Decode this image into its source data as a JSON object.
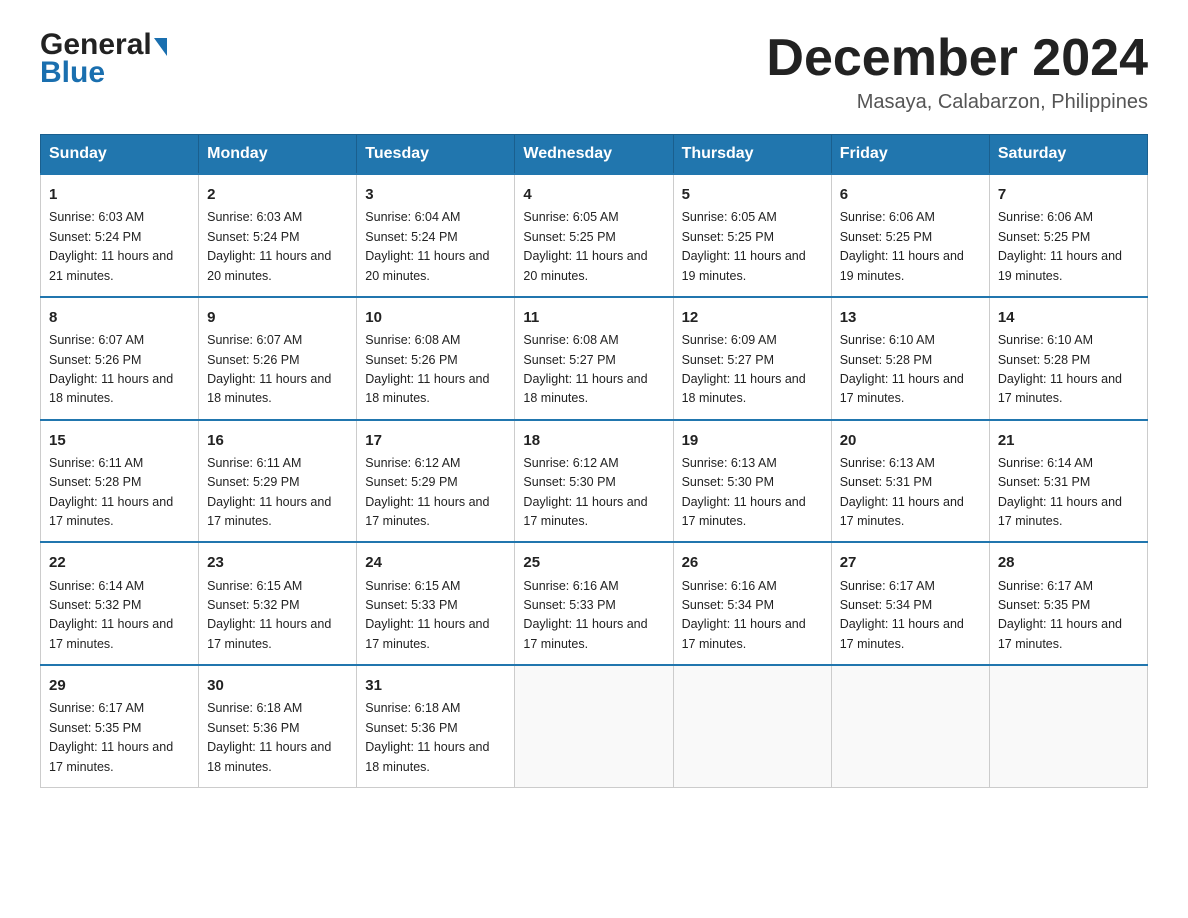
{
  "header": {
    "logo_general": "General",
    "logo_blue": "Blue",
    "month_year": "December 2024",
    "location": "Masaya, Calabarzon, Philippines"
  },
  "days_of_week": [
    "Sunday",
    "Monday",
    "Tuesday",
    "Wednesday",
    "Thursday",
    "Friday",
    "Saturday"
  ],
  "weeks": [
    [
      {
        "day": "1",
        "sunrise": "6:03 AM",
        "sunset": "5:24 PM",
        "daylight": "11 hours and 21 minutes."
      },
      {
        "day": "2",
        "sunrise": "6:03 AM",
        "sunset": "5:24 PM",
        "daylight": "11 hours and 20 minutes."
      },
      {
        "day": "3",
        "sunrise": "6:04 AM",
        "sunset": "5:24 PM",
        "daylight": "11 hours and 20 minutes."
      },
      {
        "day": "4",
        "sunrise": "6:05 AM",
        "sunset": "5:25 PM",
        "daylight": "11 hours and 20 minutes."
      },
      {
        "day": "5",
        "sunrise": "6:05 AM",
        "sunset": "5:25 PM",
        "daylight": "11 hours and 19 minutes."
      },
      {
        "day": "6",
        "sunrise": "6:06 AM",
        "sunset": "5:25 PM",
        "daylight": "11 hours and 19 minutes."
      },
      {
        "day": "7",
        "sunrise": "6:06 AM",
        "sunset": "5:25 PM",
        "daylight": "11 hours and 19 minutes."
      }
    ],
    [
      {
        "day": "8",
        "sunrise": "6:07 AM",
        "sunset": "5:26 PM",
        "daylight": "11 hours and 18 minutes."
      },
      {
        "day": "9",
        "sunrise": "6:07 AM",
        "sunset": "5:26 PM",
        "daylight": "11 hours and 18 minutes."
      },
      {
        "day": "10",
        "sunrise": "6:08 AM",
        "sunset": "5:26 PM",
        "daylight": "11 hours and 18 minutes."
      },
      {
        "day": "11",
        "sunrise": "6:08 AM",
        "sunset": "5:27 PM",
        "daylight": "11 hours and 18 minutes."
      },
      {
        "day": "12",
        "sunrise": "6:09 AM",
        "sunset": "5:27 PM",
        "daylight": "11 hours and 18 minutes."
      },
      {
        "day": "13",
        "sunrise": "6:10 AM",
        "sunset": "5:28 PM",
        "daylight": "11 hours and 17 minutes."
      },
      {
        "day": "14",
        "sunrise": "6:10 AM",
        "sunset": "5:28 PM",
        "daylight": "11 hours and 17 minutes."
      }
    ],
    [
      {
        "day": "15",
        "sunrise": "6:11 AM",
        "sunset": "5:28 PM",
        "daylight": "11 hours and 17 minutes."
      },
      {
        "day": "16",
        "sunrise": "6:11 AM",
        "sunset": "5:29 PM",
        "daylight": "11 hours and 17 minutes."
      },
      {
        "day": "17",
        "sunrise": "6:12 AM",
        "sunset": "5:29 PM",
        "daylight": "11 hours and 17 minutes."
      },
      {
        "day": "18",
        "sunrise": "6:12 AM",
        "sunset": "5:30 PM",
        "daylight": "11 hours and 17 minutes."
      },
      {
        "day": "19",
        "sunrise": "6:13 AM",
        "sunset": "5:30 PM",
        "daylight": "11 hours and 17 minutes."
      },
      {
        "day": "20",
        "sunrise": "6:13 AM",
        "sunset": "5:31 PM",
        "daylight": "11 hours and 17 minutes."
      },
      {
        "day": "21",
        "sunrise": "6:14 AM",
        "sunset": "5:31 PM",
        "daylight": "11 hours and 17 minutes."
      }
    ],
    [
      {
        "day": "22",
        "sunrise": "6:14 AM",
        "sunset": "5:32 PM",
        "daylight": "11 hours and 17 minutes."
      },
      {
        "day": "23",
        "sunrise": "6:15 AM",
        "sunset": "5:32 PM",
        "daylight": "11 hours and 17 minutes."
      },
      {
        "day": "24",
        "sunrise": "6:15 AM",
        "sunset": "5:33 PM",
        "daylight": "11 hours and 17 minutes."
      },
      {
        "day": "25",
        "sunrise": "6:16 AM",
        "sunset": "5:33 PM",
        "daylight": "11 hours and 17 minutes."
      },
      {
        "day": "26",
        "sunrise": "6:16 AM",
        "sunset": "5:34 PM",
        "daylight": "11 hours and 17 minutes."
      },
      {
        "day": "27",
        "sunrise": "6:17 AM",
        "sunset": "5:34 PM",
        "daylight": "11 hours and 17 minutes."
      },
      {
        "day": "28",
        "sunrise": "6:17 AM",
        "sunset": "5:35 PM",
        "daylight": "11 hours and 17 minutes."
      }
    ],
    [
      {
        "day": "29",
        "sunrise": "6:17 AM",
        "sunset": "5:35 PM",
        "daylight": "11 hours and 17 minutes."
      },
      {
        "day": "30",
        "sunrise": "6:18 AM",
        "sunset": "5:36 PM",
        "daylight": "11 hours and 18 minutes."
      },
      {
        "day": "31",
        "sunrise": "6:18 AM",
        "sunset": "5:36 PM",
        "daylight": "11 hours and 18 minutes."
      },
      null,
      null,
      null,
      null
    ]
  ]
}
